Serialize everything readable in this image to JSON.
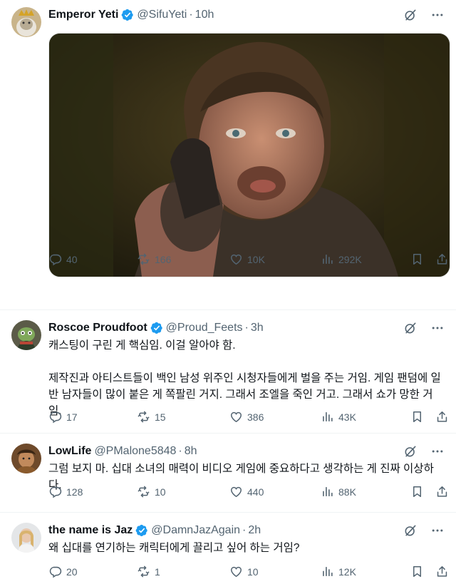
{
  "tweets": [
    {
      "name": "Emperor Yeti",
      "handle": "@SifuYeti",
      "time": "10h",
      "verified": true,
      "text": [],
      "has_media": true,
      "replies": "40",
      "retweets": "166",
      "likes": "10K",
      "views": "292K"
    },
    {
      "name": "Roscoe Proudfoot",
      "handle": "@Proud_Feets",
      "time": "3h",
      "verified": true,
      "text": [
        "캐스팅이 구린 게 핵심임. 이걸 알아야 함.",
        "제작진과 아티스트들이 백인 남성 위주인 시청자들에게 벌을 주는 거임. 게임 팬덤에 일반 남자들이 많이 붙은 게 쪽팔린 거지. 그래서 조엘을 죽인 거고. 그래서 쇼가 망한 거임."
      ],
      "replies": "17",
      "retweets": "15",
      "likes": "386",
      "views": "43K"
    },
    {
      "name": "LowLife",
      "handle": "@PMalone5848",
      "time": "8h",
      "verified": false,
      "text": [
        "그럼 보지 마. 십대 소녀의 매력이 비디오 게임에 중요하다고 생각하는 게 진짜 이상하다."
      ],
      "replies": "128",
      "retweets": "10",
      "likes": "440",
      "views": "88K"
    },
    {
      "name": "the name is Jaz",
      "handle": "@DamnJazAgain",
      "time": "2h",
      "verified": true,
      "text": [
        "왜 십대를 연기하는 캐릭터에게 끌리고 싶어 하는 거임?"
      ],
      "replies": "20",
      "retweets": "1",
      "likes": "10",
      "views": "12K"
    }
  ],
  "icons": {
    "reply": "reply-icon",
    "retweet": "retweet-icon",
    "like": "heart-icon",
    "views": "views-icon",
    "bookmark": "bookmark-icon",
    "share": "share-icon",
    "grok": "grok-icon",
    "more": "more-icon"
  },
  "colors": {
    "verified": "#1d9bf0",
    "muted": "#536471",
    "text": "#0f1419"
  }
}
